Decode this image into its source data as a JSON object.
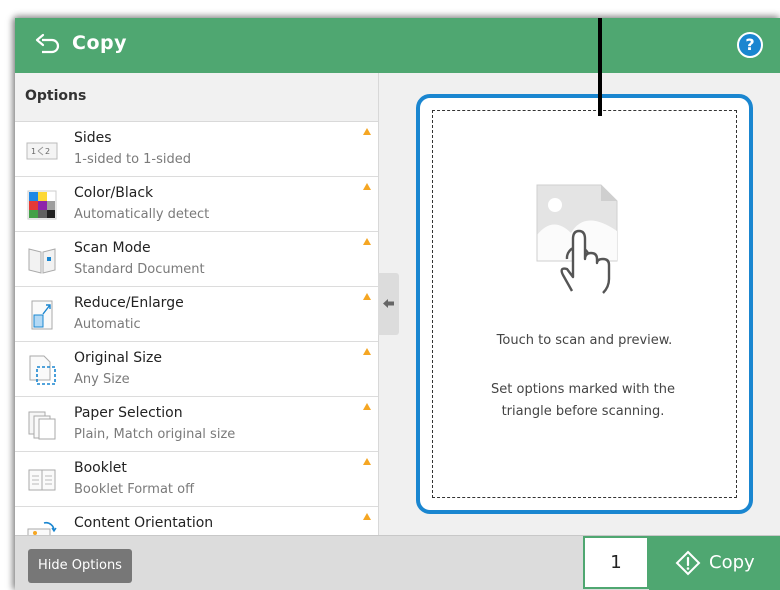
{
  "header": {
    "title": "Copy",
    "help_label": "?"
  },
  "options": {
    "heading": "Options",
    "items": [
      {
        "label": "Sides",
        "value": "1-sided to 1-sided",
        "icon": "sides-icon"
      },
      {
        "label": "Color/Black",
        "value": "Automatically detect",
        "icon": "color-black-icon"
      },
      {
        "label": "Scan Mode",
        "value": "Standard Document",
        "icon": "scan-mode-icon"
      },
      {
        "label": "Reduce/Enlarge",
        "value": "Automatic",
        "icon": "reduce-enlarge-icon"
      },
      {
        "label": "Original Size",
        "value": "Any Size",
        "icon": "original-size-icon"
      },
      {
        "label": "Paper Selection",
        "value": "Plain, Match original size",
        "icon": "paper-selection-icon"
      },
      {
        "label": "Booklet",
        "value": "Booklet Format off",
        "icon": "booklet-icon"
      },
      {
        "label": "Content Orientation",
        "value": "",
        "icon": "content-orientation-icon"
      }
    ]
  },
  "preview": {
    "line1": "Touch to scan and preview.",
    "line2": "Set options marked with the triangle before scanning."
  },
  "footer": {
    "hide_options_label": "Hide Options",
    "copies": "1",
    "copy_label": "Copy"
  },
  "colors": {
    "header_green": "#4fa771",
    "accent_blue": "#1a86d0",
    "warning_triangle": "#f5a623"
  }
}
